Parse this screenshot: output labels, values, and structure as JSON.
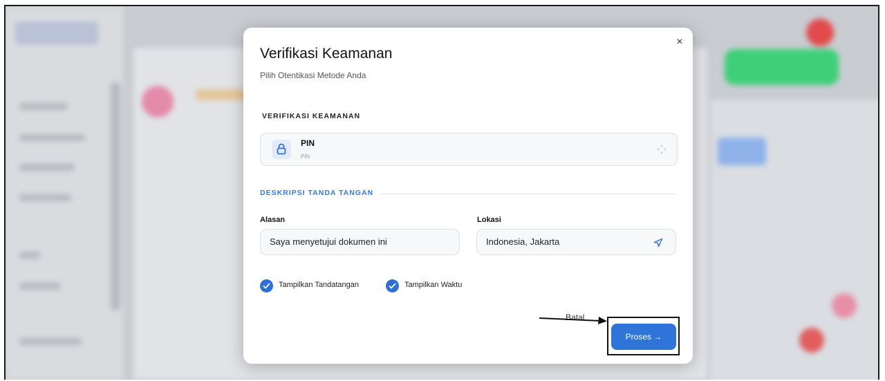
{
  "modal": {
    "title": "Verifikasi Keamanan",
    "subtitle": "Pilih Otentikasi Metode Anda",
    "close_label": "×",
    "security_section_label": "VERIFIKASI KEAMANAN",
    "method": {
      "name": "PIN",
      "sub": "PIN"
    },
    "signature_section_label": "DESKRIPSI TANDA TANGAN",
    "reason": {
      "label": "Alasan",
      "value": "Saya menyetujui dokumen ini"
    },
    "location": {
      "label": "Lokasi",
      "value": "Indonesia, Jakarta"
    },
    "checkboxes": [
      {
        "label": "Tampilkan Tandatangan",
        "checked": true
      },
      {
        "label": "Tampilkan Waktu",
        "checked": true
      }
    ],
    "cancel_label": "Batal",
    "submit_label": "Proses →"
  },
  "colors": {
    "accent": "#2f74d8",
    "section_blue": "#3a78d6"
  }
}
